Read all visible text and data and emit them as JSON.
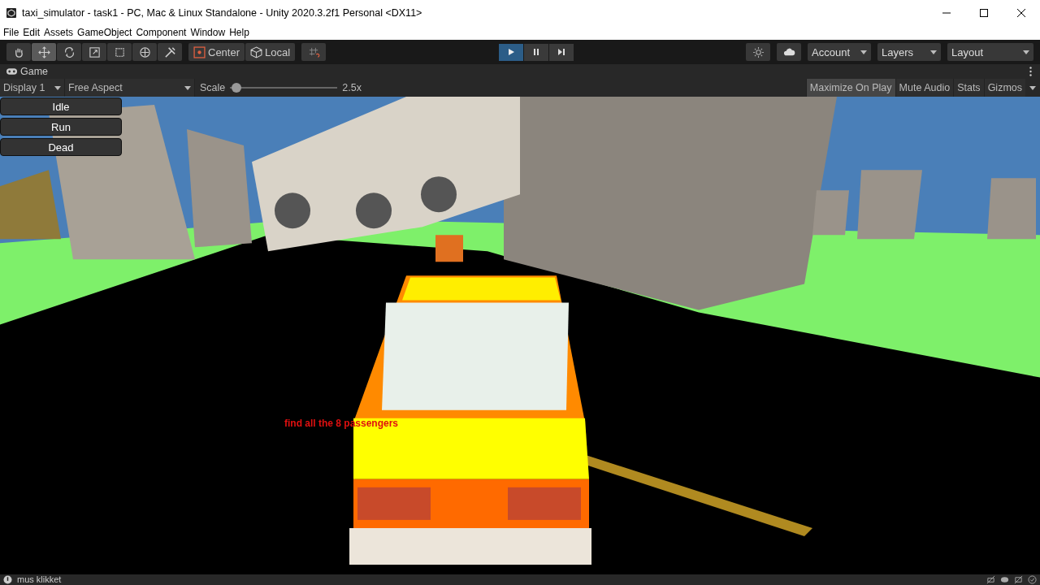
{
  "window": {
    "title": "taxi_simulator - task1 - PC, Mac & Linux Standalone - Unity 2020.3.2f1 Personal <DX11>"
  },
  "menu": [
    "File",
    "Edit",
    "Assets",
    "GameObject",
    "Component",
    "Window",
    "Help"
  ],
  "tools": [
    {
      "kind": "hand",
      "selected": false
    },
    {
      "kind": "move",
      "selected": true
    },
    {
      "kind": "rotate",
      "selected": false
    },
    {
      "kind": "scale",
      "selected": false
    },
    {
      "kind": "rect",
      "selected": false
    },
    {
      "kind": "transform",
      "selected": false
    },
    {
      "kind": "custom",
      "selected": false
    }
  ],
  "pivot": [
    {
      "kind": "center",
      "label": "Center"
    },
    {
      "kind": "local",
      "label": "Local"
    }
  ],
  "playback": [
    {
      "kind": "play",
      "selected": true
    },
    {
      "kind": "pause",
      "selected": false
    },
    {
      "kind": "step",
      "selected": false
    }
  ],
  "right_dropdowns": [
    "Account",
    "Layers",
    "Layout"
  ],
  "game_tab": {
    "label": "Game"
  },
  "game_bar": {
    "display": "Display 1",
    "aspect": "Free Aspect",
    "scale_label": "Scale",
    "scale": {
      "level": 0.06
    },
    "scale_value": "2.5x",
    "toggles": [
      {
        "label": "Maximize On Play",
        "on": true
      },
      {
        "label": "Mute Audio",
        "on": false
      },
      {
        "label": "Stats",
        "on": false
      },
      {
        "label": "Gizmos",
        "on": false
      }
    ]
  },
  "game_buttons": [
    "Idle",
    "Run",
    "Dead"
  ],
  "game_message": "find all the 8 passengers",
  "status_bar": {
    "message": "mus klikket"
  }
}
